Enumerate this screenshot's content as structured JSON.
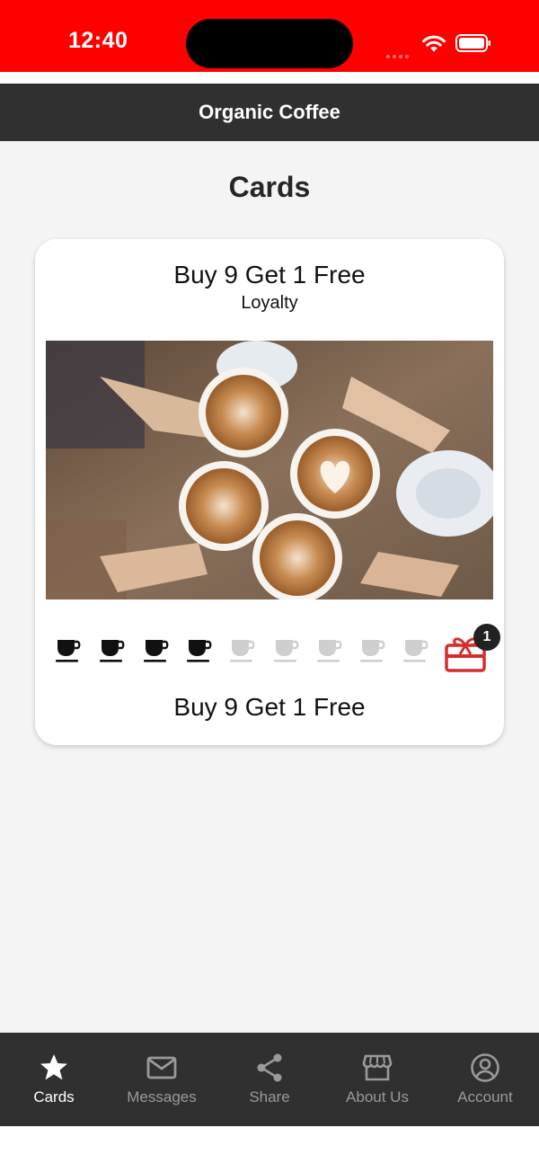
{
  "status_bar": {
    "time": "12:40",
    "background": "#fe0000"
  },
  "header": {
    "title": "Organic Coffee",
    "background": "#303030"
  },
  "page": {
    "title": "Cards"
  },
  "card": {
    "title": "Buy 9 Get 1 Free",
    "subtitle": "Loyalty",
    "image_icon": "coffee-cups-photo",
    "stamps_total": 9,
    "stamps_filled": 4,
    "stamp_icon": "coffee-cup-icon",
    "reward_icon": "gift-card-icon",
    "reward_badge": "1",
    "reward_color": "#d32f2f",
    "footer_text": "Buy 9 Get 1 Free"
  },
  "tab_bar": {
    "tabs": [
      {
        "label": "Cards",
        "icon": "star-icon",
        "active": true
      },
      {
        "label": "Messages",
        "icon": "mail-icon",
        "active": false
      },
      {
        "label": "Share",
        "icon": "share-icon",
        "active": false
      },
      {
        "label": "About Us",
        "icon": "storefront-icon",
        "active": false
      },
      {
        "label": "Account",
        "icon": "account-icon",
        "active": false
      }
    ]
  }
}
